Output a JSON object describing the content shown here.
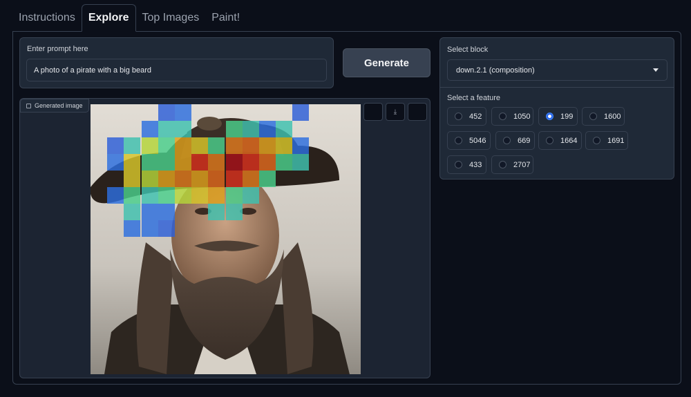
{
  "tabs": [
    {
      "label": "Instructions",
      "active": false
    },
    {
      "label": "Explore",
      "active": true
    },
    {
      "label": "Top Images",
      "active": false
    },
    {
      "label": "Paint!",
      "active": false
    }
  ],
  "prompt": {
    "label": "Enter prompt here",
    "value": "A photo of a pirate with a big beard"
  },
  "generate_label": "Generate",
  "image": {
    "badge_label": "Generated image"
  },
  "block": {
    "label": "Select block",
    "selected": "down.2.1 (composition)"
  },
  "features": {
    "label": "Select a feature",
    "options": [
      "452",
      "1050",
      "199",
      "1600",
      "5046",
      "669",
      "1664",
      "1691",
      "433",
      "2707"
    ],
    "selected": "199"
  },
  "colors": {
    "accent": "#2563eb",
    "background": "#0b0f19",
    "panel": "#1f2937",
    "border": "#374151"
  }
}
